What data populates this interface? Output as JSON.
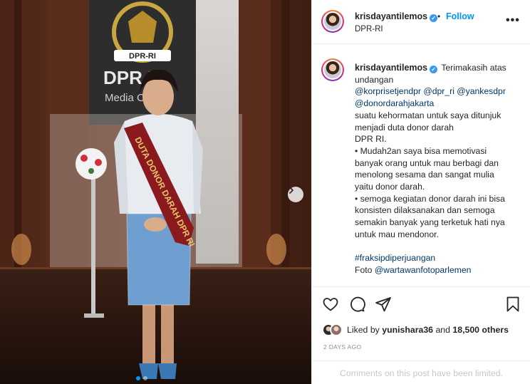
{
  "photo": {
    "emblem_text": "DPR-RI",
    "wall_text_1": "DPR RI",
    "wall_text_2": "Media Center",
    "sash_text": "DUTA DONOR DARAH DPR RI",
    "carousel_dots": 2,
    "active_dot": 0,
    "next_icon": "chevron-right-icon"
  },
  "header": {
    "username": "krisdayantilemos",
    "verified": true,
    "separator": "•",
    "follow_label": "Follow",
    "location": "DPR-RI",
    "more_icon": "more-options-icon",
    "more_label": "•••"
  },
  "caption": {
    "username": "krisdayantilemos",
    "lines": [
      "Terimakasih atas",
      "undangan",
      "@korprisetjendpr @dpr_ri @yankesdpr",
      "@donordarahjakarta",
      "suatu kehormatan untuk saya ditunjuk",
      "menjadi duta donor darah",
      "DPR RI.",
      "• Mudah2an saya bisa memotivasi",
      "banyak orang untuk mau berbagi dan",
      "menolong sesama dan sangat mulia",
      "yaitu donor darah.",
      "• semoga kegiatan donor darah ini bisa",
      "konsisten dilaksanakan dan semoga",
      "semakin banyak yang terketuk hati nya",
      "untuk mau mendonor."
    ],
    "hashtag": "#fraksipdiperjuangan",
    "photo_credit_prefix": "Foto",
    "photo_credit_handle": "@wartawanfotoparlemen"
  },
  "actions": {
    "like_icon": "heart-icon",
    "comment_icon": "comment-icon",
    "share_icon": "share-icon",
    "save_icon": "bookmark-icon"
  },
  "likes": {
    "prefix": "Liked by",
    "user": "yunishara36",
    "middle": "and",
    "others": "18,500 others"
  },
  "timestamp": "2 DAYS AGO",
  "comments_notice": "Comments on this post have been limited.",
  "colors": {
    "accent": "#0095f6",
    "link": "#00376b",
    "muted": "#8e8e8e",
    "sash": "#8b1a1f",
    "sash_text": "#e8c36a"
  }
}
